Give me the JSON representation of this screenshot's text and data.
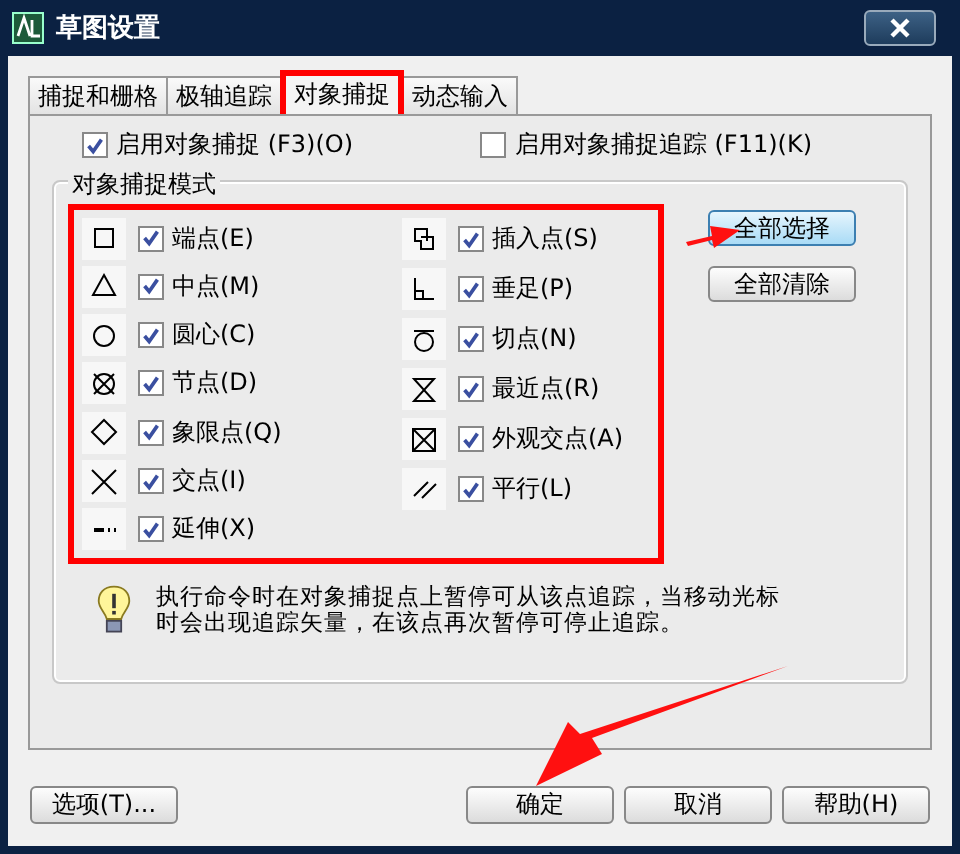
{
  "window": {
    "title": "草图设置"
  },
  "tabs": [
    {
      "label": "捕捉和栅格",
      "selected": false
    },
    {
      "label": "极轴追踪",
      "selected": false
    },
    {
      "label": "对象捕捉",
      "selected": true
    },
    {
      "label": "动态输入",
      "selected": false
    }
  ],
  "enable_snap": {
    "label": "启用对象捕捉 (F3)(O)",
    "checked": true
  },
  "enable_tracking": {
    "label": "启用对象捕捉追踪 (F11)(K)",
    "checked": false
  },
  "group": {
    "title": "对象捕捉模式"
  },
  "modes_left": [
    {
      "label": "端点(E)",
      "checked": true
    },
    {
      "label": "中点(M)",
      "checked": true
    },
    {
      "label": "圆心(C)",
      "checked": true
    },
    {
      "label": "节点(D)",
      "checked": true
    },
    {
      "label": "象限点(Q)",
      "checked": true
    },
    {
      "label": "交点(I)",
      "checked": true
    },
    {
      "label": "延伸(X)",
      "checked": true
    }
  ],
  "modes_right": [
    {
      "label": "插入点(S)",
      "checked": true
    },
    {
      "label": "垂足(P)",
      "checked": true
    },
    {
      "label": "切点(N)",
      "checked": true
    },
    {
      "label": "最近点(R)",
      "checked": true
    },
    {
      "label": "外观交点(A)",
      "checked": true
    },
    {
      "label": "平行(L)",
      "checked": true
    }
  ],
  "side_buttons": [
    {
      "label": "全部选择",
      "selected": true
    },
    {
      "label": "全部清除",
      "selected": false
    }
  ],
  "tip": "执行命令时在对象捕捉点上暂停可从该点追踪，当移动光标时会出现追踪矢量，在该点再次暂停可停止追踪。",
  "footer": {
    "options_button": "选项(T)...",
    "buttons": [
      "确定",
      "取消",
      "帮助(H)"
    ]
  }
}
